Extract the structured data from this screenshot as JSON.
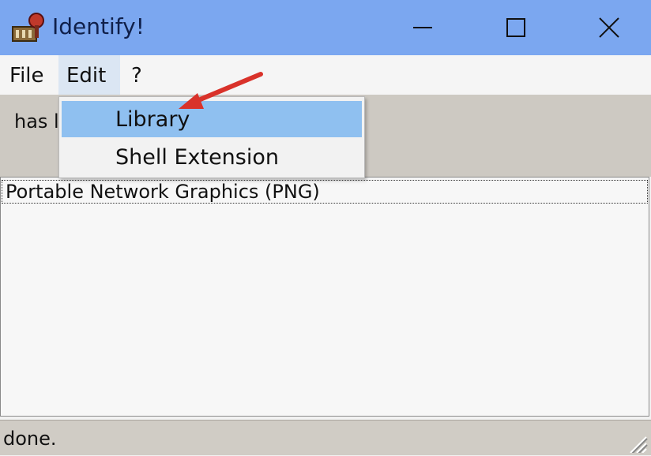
{
  "window": {
    "title": "Identify!",
    "icon": "identify-app-icon",
    "controls": [
      "minimize-icon",
      "maximize-icon",
      "close-icon"
    ]
  },
  "menubar": {
    "items": [
      {
        "label": "File"
      },
      {
        "label": "Edit"
      },
      {
        "label": "?"
      }
    ]
  },
  "panel": {
    "text": "has l"
  },
  "edit_menu": {
    "items": [
      {
        "label": "Library",
        "highlighted": true
      },
      {
        "label": "Shell Extension"
      }
    ]
  },
  "list": {
    "rows": [
      {
        "label": "Portable Network Graphics (PNG)"
      }
    ]
  },
  "statusbar": {
    "text": "done."
  },
  "colors": {
    "titlebar": "#7ba7f0",
    "menu_highlight": "#8fc0f0",
    "annotation_arrow": "#d9322a"
  }
}
